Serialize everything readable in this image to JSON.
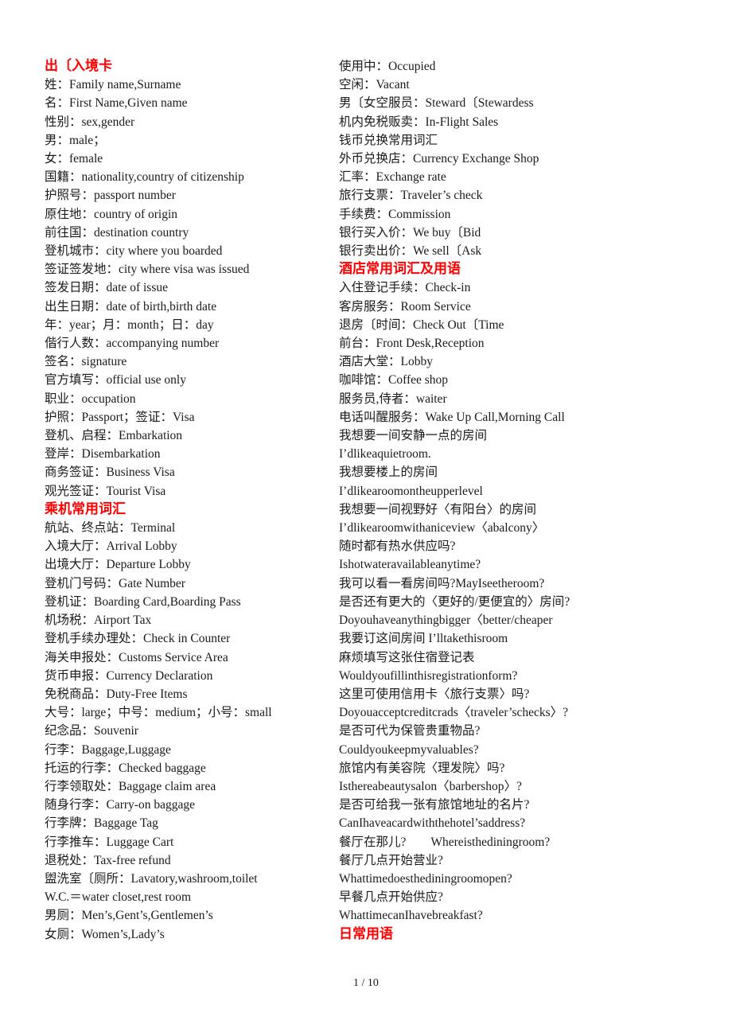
{
  "document": {
    "page_label": "1 / 10",
    "colors": {
      "heading": "#ff0000",
      "body": "#1a1a1a",
      "background": "#ffffff"
    }
  },
  "left_column": {
    "lines": [
      {
        "text": "出〔入境卡",
        "heading": true
      },
      {
        "text": "姓：Family name,Surname",
        "heading": false
      },
      {
        "text": "名：First Name,Given name",
        "heading": false
      },
      {
        "text": "性别：sex,gender",
        "heading": false
      },
      {
        "text": "男：male；",
        "heading": false
      },
      {
        "text": "女：female",
        "heading": false
      },
      {
        "text": "国籍：nationality,country of citizenship",
        "heading": false
      },
      {
        "text": "护照号：passport number",
        "heading": false
      },
      {
        "text": "原住地：country of origin",
        "heading": false
      },
      {
        "text": "前往国：destination country",
        "heading": false
      },
      {
        "text": "登机城市：city where you boarded",
        "heading": false
      },
      {
        "text": "签证签发地：city where visa was issued",
        "heading": false
      },
      {
        "text": "签发日期：date of issue",
        "heading": false
      },
      {
        "text": "出生日期：date of birth,birth date",
        "heading": false
      },
      {
        "text": "年：year；月：month；日：day",
        "heading": false
      },
      {
        "text": "偕行人数：accompanying number",
        "heading": false
      },
      {
        "text": "签名：signature",
        "heading": false
      },
      {
        "text": "官方填写：official use only",
        "heading": false
      },
      {
        "text": "职业：occupation",
        "heading": false
      },
      {
        "text": "护照：Passport；签证：Visa",
        "heading": false
      },
      {
        "text": "登机、启程：Embarkation",
        "heading": false
      },
      {
        "text": "登岸：Disembarkation",
        "heading": false
      },
      {
        "text": "商务签证：Business Visa",
        "heading": false
      },
      {
        "text": "观光签证：Tourist Visa",
        "heading": false
      },
      {
        "text": "乘机常用词汇",
        "heading": true
      },
      {
        "text": "航站、终点站：Terminal",
        "heading": false
      },
      {
        "text": "入境大厅：Arrival Lobby",
        "heading": false
      },
      {
        "text": "出境大厅：Departure Lobby",
        "heading": false
      },
      {
        "text": "登机门号码：Gate Number",
        "heading": false
      },
      {
        "text": "登机证：Boarding Card,Boarding Pass",
        "heading": false
      },
      {
        "text": "机场税：Airport Tax",
        "heading": false
      },
      {
        "text": "登机手续办理处：Check in Counter",
        "heading": false
      },
      {
        "text": "海关申报处：Customs Service Area",
        "heading": false
      },
      {
        "text": "货币申报：Currency Declaration",
        "heading": false
      },
      {
        "text": "免税商品：Duty-Free Items",
        "heading": false
      },
      {
        "text": "大号：large；中号：medium；小号：small",
        "heading": false
      },
      {
        "text": "纪念品：Souvenir",
        "heading": false
      },
      {
        "text": "行李：Baggage,Luggage",
        "heading": false
      },
      {
        "text": "托运的行李：Checked baggage",
        "heading": false
      },
      {
        "text": "行李领取处：Baggage claim area",
        "heading": false
      },
      {
        "text": "随身行李：Carry-on baggage",
        "heading": false
      },
      {
        "text": "行李牌：Baggage Tag",
        "heading": false
      },
      {
        "text": "行李推车：Luggage Cart",
        "heading": false
      },
      {
        "text": "退税处：Tax-free refund",
        "heading": false
      },
      {
        "text": "盥洗室〔厕所：Lavatory,washroom,toilet",
        "heading": false
      },
      {
        "text": "W.C.＝water closet,rest room",
        "heading": false
      },
      {
        "text": "男厕：Men’s,Gent’s,Gentlemen’s",
        "heading": false
      },
      {
        "text": "女厕：Women’s,Lady’s",
        "heading": false
      }
    ]
  },
  "right_column": {
    "lines": [
      {
        "text": "使用中：Occupied",
        "heading": false
      },
      {
        "text": "空闲：Vacant",
        "heading": false
      },
      {
        "text": "男〔女空服员：Steward〔Stewardess",
        "heading": false
      },
      {
        "text": "机内免税贩卖：In-Flight Sales",
        "heading": false
      },
      {
        "text": "钱币兑换常用词汇",
        "heading": false
      },
      {
        "text": "外币兑换店：Currency Exchange Shop",
        "heading": false
      },
      {
        "text": "汇率：Exchange rate",
        "heading": false
      },
      {
        "text": "旅行支票：Traveler’s check",
        "heading": false
      },
      {
        "text": "手续费：Commission",
        "heading": false
      },
      {
        "text": "银行买入价：We buy〔Bid",
        "heading": false
      },
      {
        "text": "银行卖出价：We sell〔Ask",
        "heading": false
      },
      {
        "text": "酒店常用词汇及用语",
        "heading": true
      },
      {
        "text": "入住登记手续：Check-in",
        "heading": false
      },
      {
        "text": "客房服务：Room Service",
        "heading": false
      },
      {
        "text": "退房〔时间：Check Out〔Time",
        "heading": false
      },
      {
        "text": "前台：Front Desk,Reception",
        "heading": false
      },
      {
        "text": "酒店大堂：Lobby",
        "heading": false
      },
      {
        "text": "咖啡馆：Coffee shop",
        "heading": false
      },
      {
        "text": "服务员,侍者：waiter",
        "heading": false
      },
      {
        "text": "电话叫醒服务：Wake Up Call,Morning Call",
        "heading": false
      },
      {
        "text": "我想要一间安静一点的房间",
        "heading": false
      },
      {
        "text": "I’dlikeaquietroom.",
        "heading": false
      },
      {
        "text": "我想要楼上的房间",
        "heading": false
      },
      {
        "text": "I’dlikearoomontheupperlevel",
        "heading": false
      },
      {
        "text": "我想要一间视野好〈有阳台〉的房间",
        "heading": false
      },
      {
        "text": "I’dlikearoomwithaniceview〈abalcony〉",
        "heading": false
      },
      {
        "text": "随时都有热水供应吗?",
        "heading": false
      },
      {
        "text": "Ishotwateravailableanytime?",
        "heading": false
      },
      {
        "text": "我可以看一看房间吗?MayIseetheroom?",
        "heading": false
      },
      {
        "text": "是否还有更大的〈更好的/更便宜的〉房间?",
        "heading": false
      },
      {
        "text": "Doyouhaveanythingbigger〈better/cheaper",
        "heading": false
      },
      {
        "text": "我要订这间房间 I’lltakethisroom",
        "heading": false
      },
      {
        "text": "麻烦填写这张住宿登记表",
        "heading": false
      },
      {
        "text": "Wouldyoufillinthisregistrationform?",
        "heading": false
      },
      {
        "text": "这里可使用信用卡〈旅行支票〉吗?",
        "heading": false
      },
      {
        "text": "Doyouacceptcreditcrads〈traveler’schecks〉?",
        "heading": false
      },
      {
        "text": "是否可代为保管贵重物品?",
        "heading": false
      },
      {
        "text": "Couldyoukeepmyvaluables?",
        "heading": false
      },
      {
        "text": "旅馆内有美容院〈理发院〉吗?",
        "heading": false
      },
      {
        "text": "Isthereabeautysalon〈barbershop〉?",
        "heading": false
      },
      {
        "text": "是否可给我一张有旅馆地址的名片?",
        "heading": false
      },
      {
        "text": "CanIhaveacardwiththehotel’saddress?",
        "heading": false
      },
      {
        "text": "餐厅在那儿?　　Whereisthediningroom?",
        "heading": false
      },
      {
        "text": "餐厅几点开始营业?",
        "heading": false
      },
      {
        "text": "Whattimedoesthediningroomopen?",
        "heading": false
      },
      {
        "text": "早餐几点开始供应?",
        "heading": false
      },
      {
        "text": "WhattimecanIhavebreakfast?",
        "heading": false
      },
      {
        "text": "日常用语",
        "heading": true
      }
    ]
  }
}
